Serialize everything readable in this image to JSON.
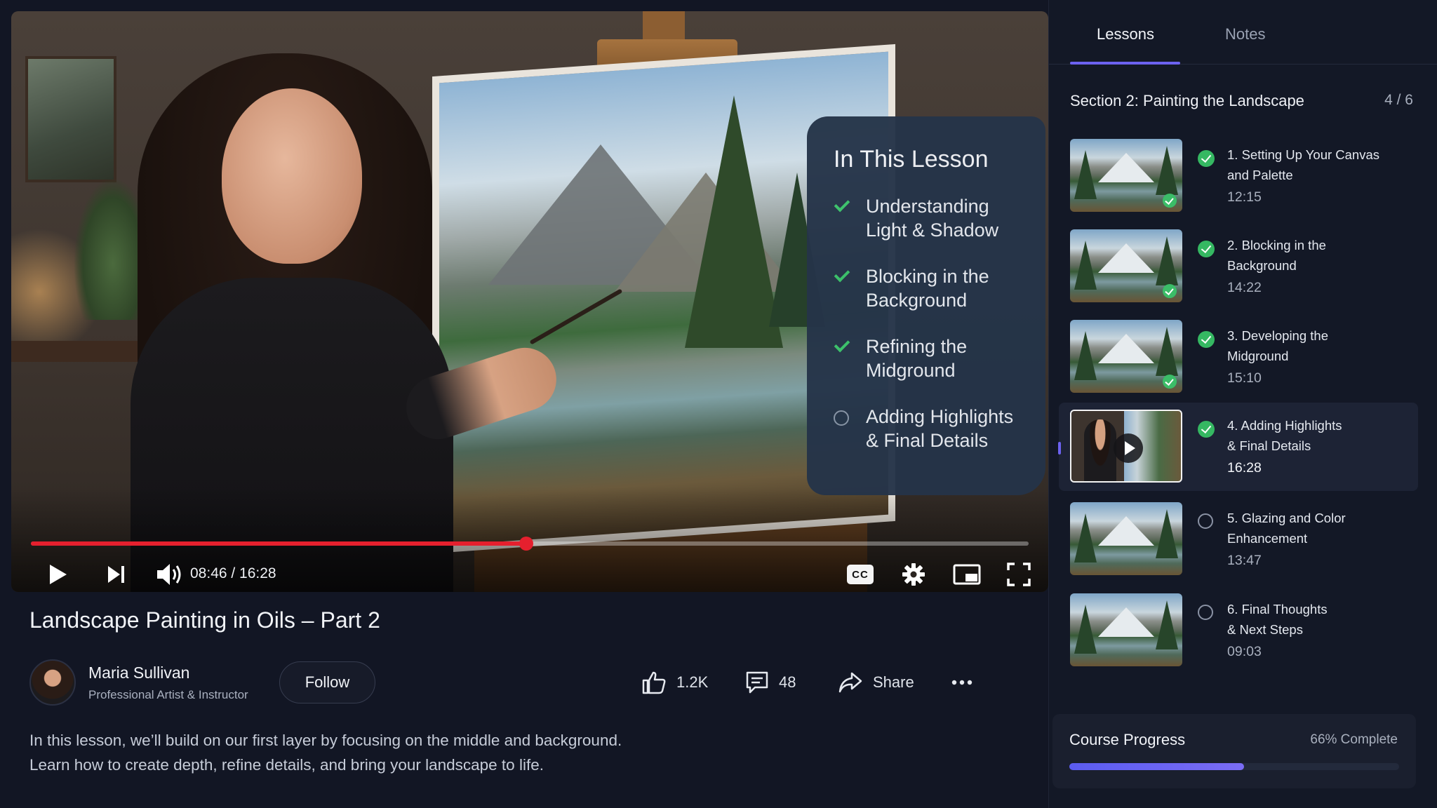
{
  "video": {
    "progress_fraction": 0.4966,
    "time_display": "08:46 / 16:28",
    "cc_label": "CC",
    "overlay": {
      "title": "In This Lesson",
      "items": [
        {
          "text_line1": "Understanding",
          "text_line2": "Light & Shadow",
          "done": true
        },
        {
          "text_line1": "Blocking in the",
          "text_line2": "Background",
          "done": true
        },
        {
          "text_line1": "Refining the",
          "text_line2": "Midground",
          "done": true
        },
        {
          "text_line1": "Adding Highlights",
          "text_line2": "& Final Details",
          "done": false
        }
      ]
    }
  },
  "title": "Landscape Painting in Oils – Part 2",
  "channel": {
    "name": "Maria Sullivan",
    "role": "Professional Artist & Instructor",
    "follow_label": "Follow"
  },
  "actions": {
    "likes": "1.2K",
    "comments": "48",
    "share_label": "Share"
  },
  "description": {
    "line1": "In this lesson, we’ll build on our first layer by focusing on the middle and background.",
    "line2": "Learn how to create depth, refine details, and bring your landscape to life."
  },
  "sidebar": {
    "tabs": [
      {
        "label": "Lessons",
        "active": true
      },
      {
        "label": "Notes",
        "active": false
      }
    ],
    "section_title": "Section 2: Painting the Landscape",
    "section_count": "4 / 6",
    "lessons": [
      {
        "line1": "1. Setting Up Your Canvas",
        "line2": "and Palette",
        "duration": "12:15",
        "status": "done"
      },
      {
        "line1": "2. Blocking in the",
        "line2": "Background",
        "duration": "14:22",
        "status": "done"
      },
      {
        "line1": "3. Developing the",
        "line2": "Midground",
        "duration": "15:10",
        "status": "done"
      },
      {
        "line1": "4. Adding Highlights",
        "line2": "& Final Details",
        "duration": "16:28",
        "status": "done",
        "playing": true
      },
      {
        "line1": "5. Glazing and Color",
        "line2": "Enhancement",
        "duration": "13:47",
        "status": "todo"
      },
      {
        "line1": "6. Final Thoughts",
        "line2": "& Next Steps",
        "duration": "09:03",
        "status": "todo"
      }
    ],
    "course_progress": {
      "title": "Course Progress",
      "percent_label": "66% Complete",
      "fraction": 0.53
    }
  },
  "colors": {
    "accent": "#6c62f0",
    "progress_red": "#e5202e",
    "check_green": "#35b862",
    "background": "#121624"
  }
}
